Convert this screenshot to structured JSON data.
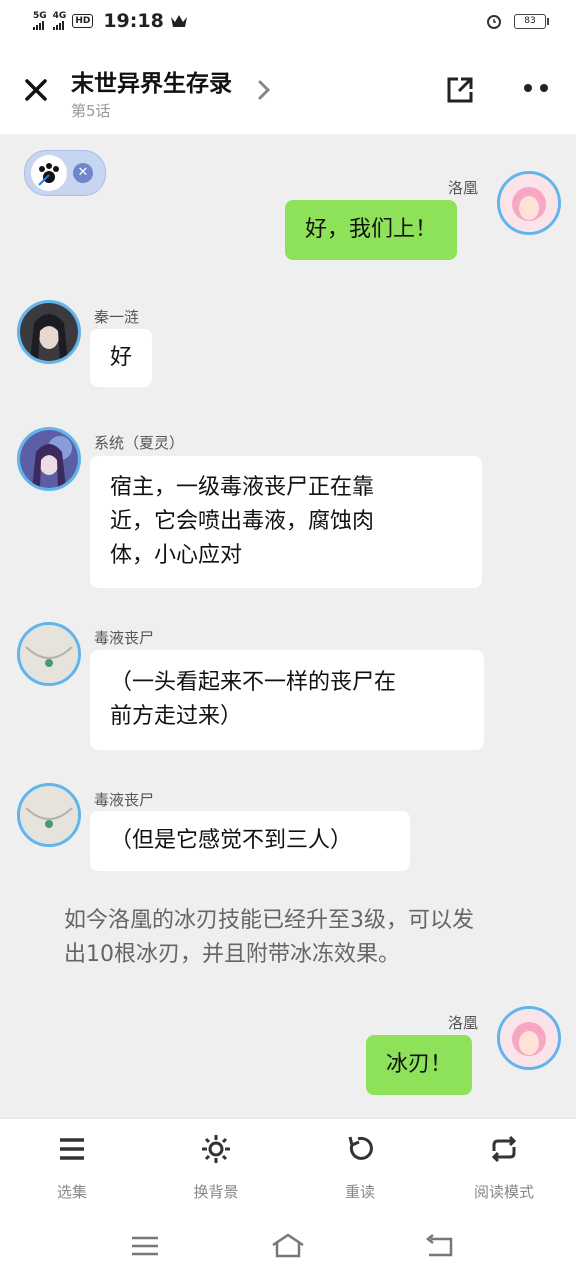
{
  "status_bar": {
    "network1": "5G",
    "network2": "4G",
    "hd": "HD",
    "time": "19:18",
    "battery": "83"
  },
  "header": {
    "title": "末世异界生存录",
    "subtitle": "第5话"
  },
  "messages": [
    {
      "speaker": "洛凰",
      "text": "好，我们上！",
      "side": "right"
    },
    {
      "speaker": "秦一涟",
      "text": "好",
      "side": "left"
    },
    {
      "speaker": "系统（夏灵）",
      "text_lines": [
        "宿主，一级毒液丧尸正在靠",
        "近，它会喷出毒液，腐蚀肉",
        "体，小心应对"
      ],
      "side": "left"
    },
    {
      "speaker": "毒液丧尸",
      "text_lines": [
        "（一头看起来不一样的丧尸在",
        "前方走过来）"
      ],
      "side": "left"
    },
    {
      "speaker": "毒液丧尸",
      "text": "（但是它感觉不到三人）",
      "side": "left"
    },
    {
      "speaker": "洛凰",
      "text": "冰刃！",
      "side": "right"
    }
  ],
  "narration": [
    "如今洛凰的冰刃技能已经升至3级，可以发",
    "出10根冰刃，并且附带冰冻效果。"
  ],
  "toolbar": {
    "select_episode": "选集",
    "change_background": "换背景",
    "reread": "重读",
    "reading_mode": "阅读模式"
  },
  "colors": {
    "bubble_green": "#8ee25a",
    "bubble_white": "#ffffff",
    "avatar_ring": "#5fb5ec",
    "background": "#efefef"
  }
}
